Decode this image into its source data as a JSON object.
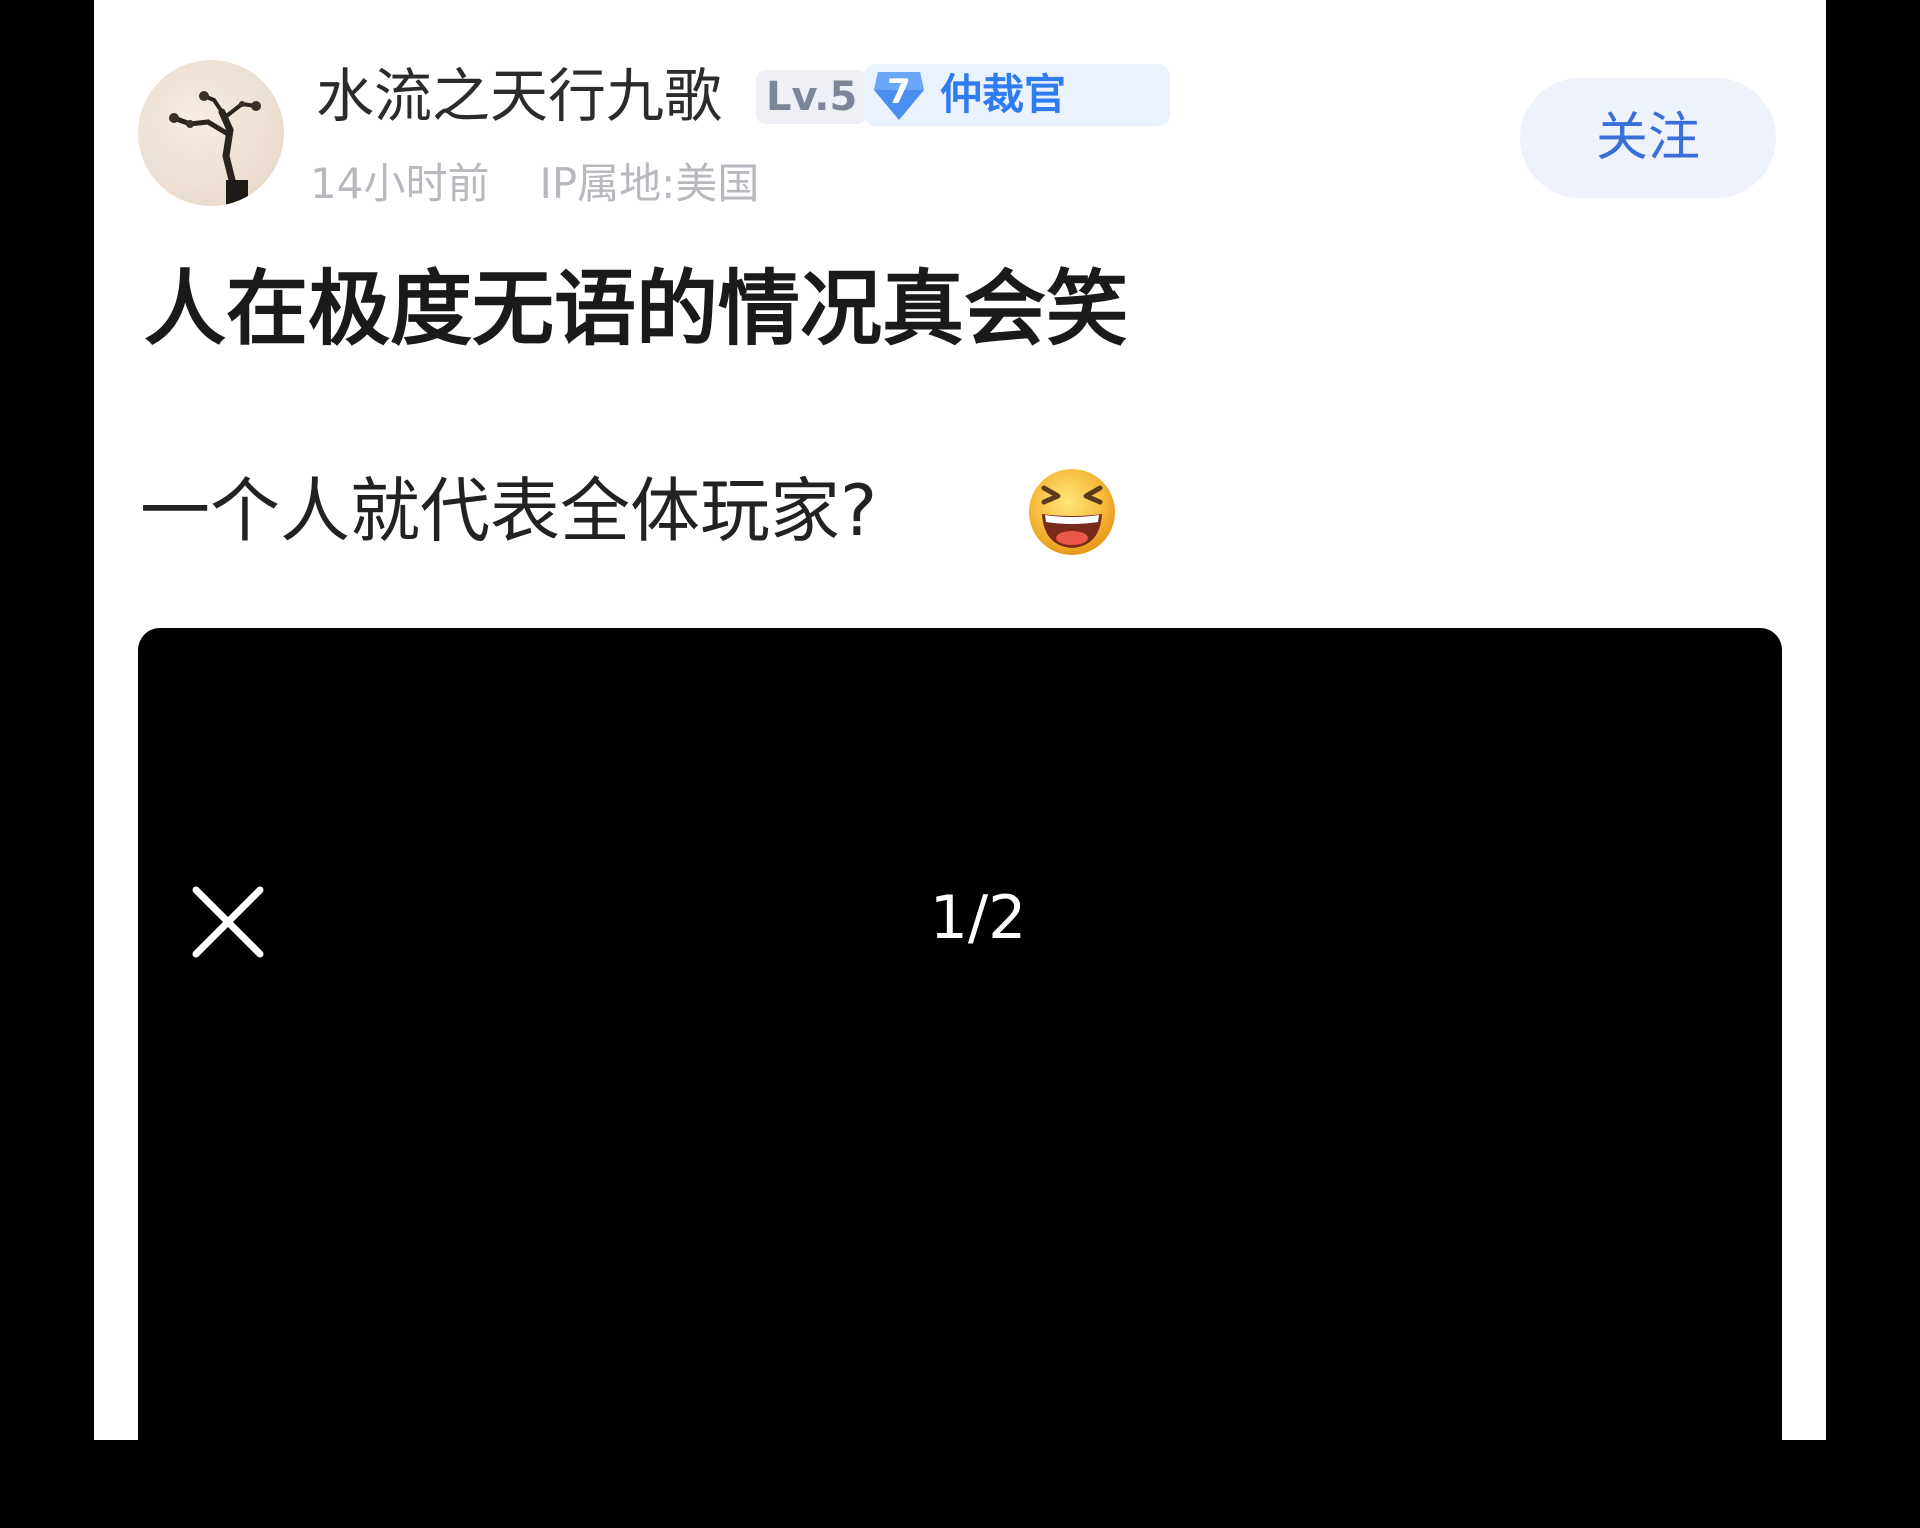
{
  "post": {
    "author": {
      "avatar_icon": "avatar-bonsai-icon",
      "username": "水流之天行九歌",
      "level": "Lv.5",
      "role_badge": {
        "number": "7",
        "label": "仲裁官",
        "color": "#2f7bf0"
      },
      "time_ago": "14小时前",
      "ip_location": "IP属地:美国"
    },
    "follow_label": "关注",
    "title": "人在极度无语的情况真会笑",
    "body": "一个人就代表全体玩家?",
    "emoji_icon": "laughing-emoji-icon",
    "media": {
      "close_icon": "close-icon",
      "counter": "1/2"
    }
  },
  "colors": {
    "accent": "#3b6fd8",
    "follow_bg": "#eef2fb",
    "meta_text": "#b7b9bf"
  }
}
